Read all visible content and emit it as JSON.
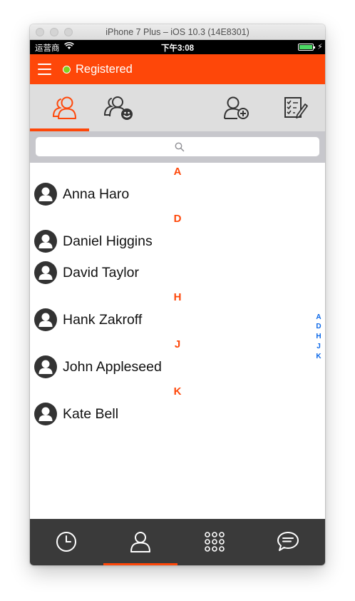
{
  "window": {
    "title": "iPhone 7 Plus – iOS 10.3 (14E8301)"
  },
  "statusbar": {
    "carrier": "运营商",
    "time": "下午3:08"
  },
  "header": {
    "status_label": "Registered",
    "status_color": "#7ed321",
    "brand_color": "#fe4709"
  },
  "tabs": [
    {
      "icon": "contacts-icon",
      "active": true
    },
    {
      "icon": "buddy-group-icon",
      "active": false
    },
    {
      "icon": "add-contact-icon",
      "active": false
    },
    {
      "icon": "checklist-edit-icon",
      "active": false
    }
  ],
  "search": {
    "icon": "search-icon"
  },
  "sections": [
    {
      "letter": "A",
      "contacts": [
        "Anna Haro"
      ]
    },
    {
      "letter": "D",
      "contacts": [
        "Daniel Higgins",
        "David Taylor"
      ]
    },
    {
      "letter": "H",
      "contacts": [
        "Hank Zakroff"
      ]
    },
    {
      "letter": "J",
      "contacts": [
        "John Appleseed"
      ]
    },
    {
      "letter": "K",
      "contacts": [
        "Kate Bell"
      ]
    }
  ],
  "index_letters": [
    "A",
    "D",
    "H",
    "J",
    "K"
  ],
  "bottom_tabs": [
    {
      "icon": "clock-icon",
      "active": false
    },
    {
      "icon": "contact-person-icon",
      "active": true
    },
    {
      "icon": "dialpad-icon",
      "active": false
    },
    {
      "icon": "chat-bubble-icon",
      "active": false
    }
  ]
}
